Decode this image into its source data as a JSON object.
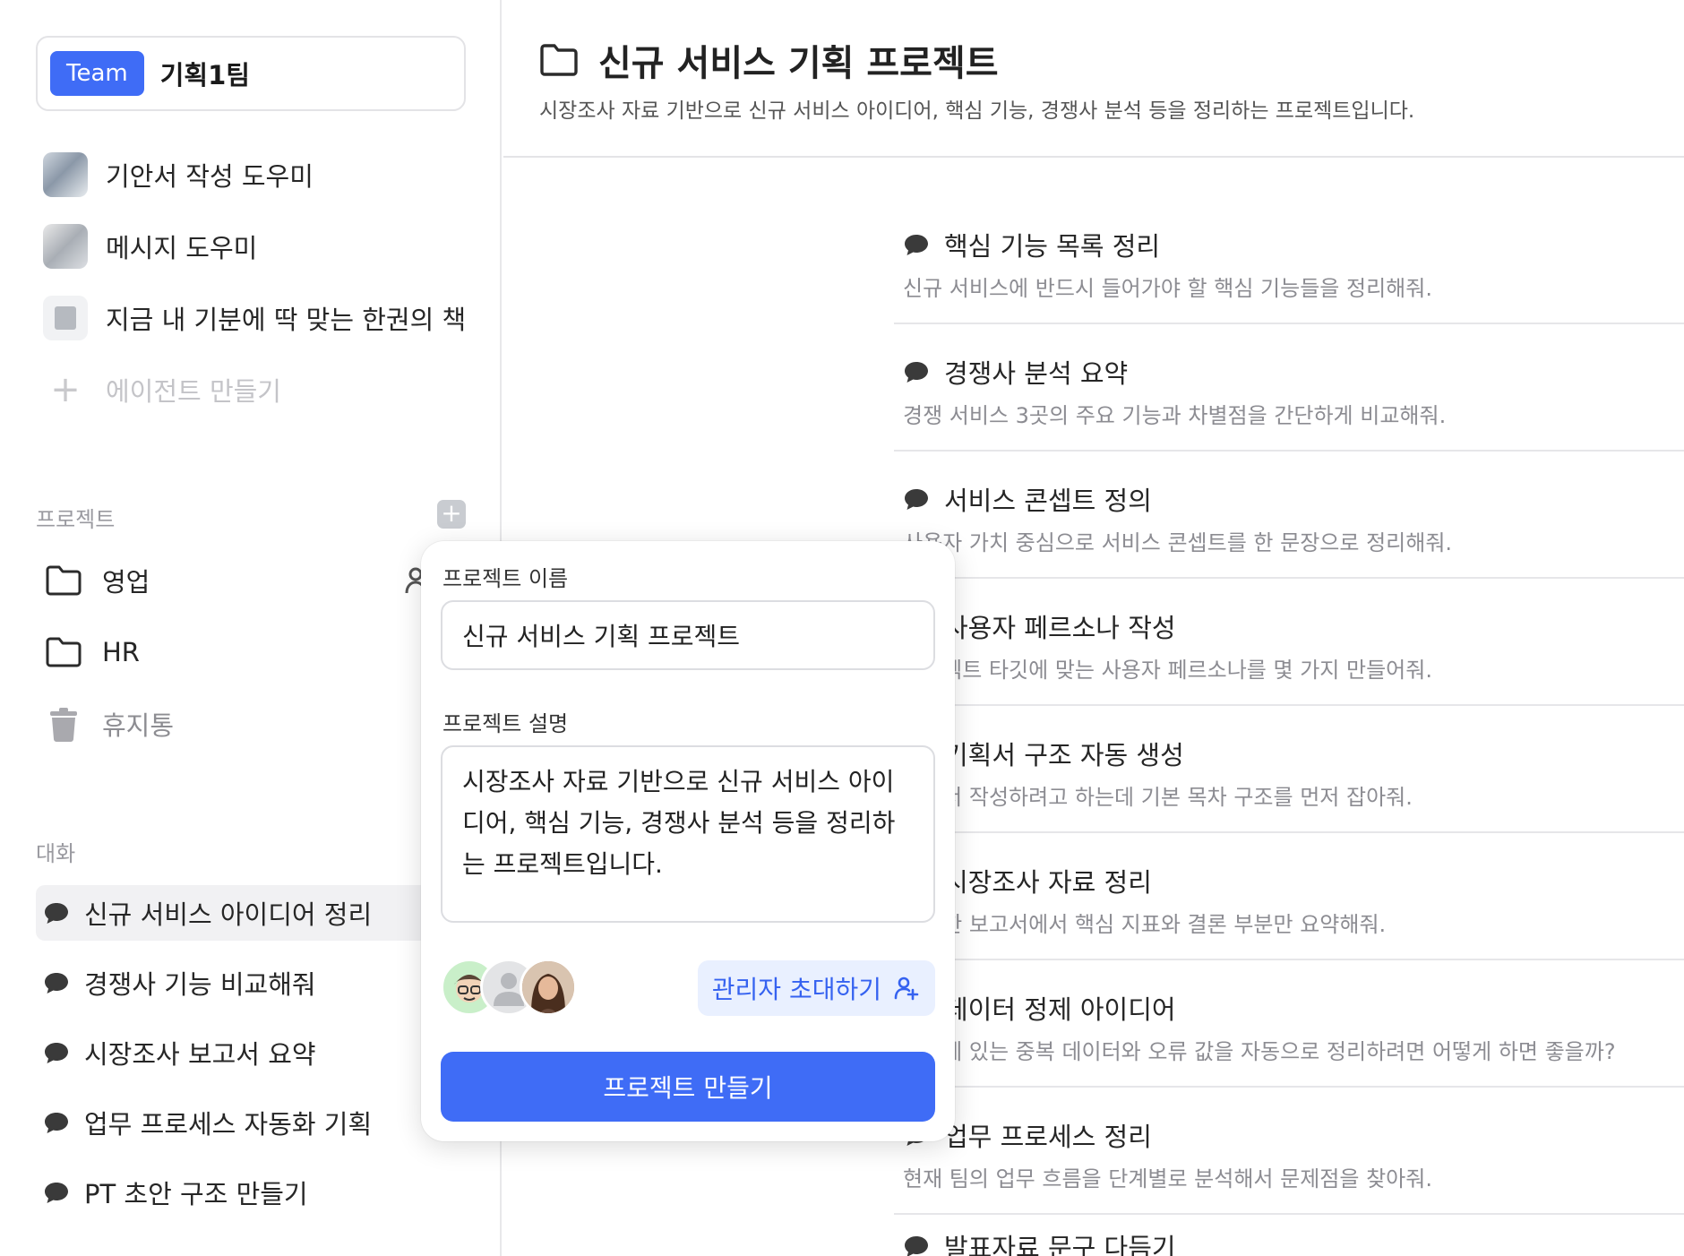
{
  "sidebar": {
    "team_badge": "Team",
    "team_name": "기획1팀",
    "agents": [
      {
        "label": "기안서 작성 도우미"
      },
      {
        "label": "메시지 도우미"
      },
      {
        "label": "지금 내 기분에 딱 맞는 한권의 책"
      }
    ],
    "add_agent": "에이전트 만들기",
    "projects_section": "프로젝트",
    "projects": [
      {
        "label": "영업"
      },
      {
        "label": "HR"
      },
      {
        "label": "휴지통"
      }
    ],
    "chats_section": "대화",
    "chats": [
      {
        "label": "신규 서비스 아이디어 정리",
        "active": true
      },
      {
        "label": "경쟁사 기능 비교해줘"
      },
      {
        "label": "시장조사 보고서 요약"
      },
      {
        "label": "업무 프로세스 자동화 기획"
      },
      {
        "label": "PT 초안 구조 만들기"
      }
    ]
  },
  "main": {
    "title": "신규 서비스 기획 프로젝트",
    "description": "시장조사 자료 기반으로 신규 서비스 아이디어, 핵심 기능, 경쟁사 분석 등을 정리하는 프로젝트입니다.",
    "prompts": [
      {
        "title": "핵심 기능 목록 정리",
        "desc": "신규 서비스에 반드시 들어가야 할 핵심 기능들을 정리해줘."
      },
      {
        "title": "경쟁사 분석 요약",
        "desc": "경쟁 서비스 3곳의 주요 기능과 차별점을 간단하게 비교해줘."
      },
      {
        "title": "서비스 콘셉트 정의",
        "desc": "사용자 가치 중심으로 서비스 콘셉트를 한 문장으로 정리해줘."
      },
      {
        "title": "사용자 페르소나 작성",
        "desc": "프로젝트 타깃에 맞는 사용자 페르소나를 몇 가지 만들어줘."
      },
      {
        "title": "기획서 구조 자동 생성",
        "desc": "기획서 작성하려고 하는데 기본 목차 구조를 먼저 잡아줘."
      },
      {
        "title": "시장조사 자료 정리",
        "desc": "첨부한 보고서에서 핵심 지표와 결론 부분만 요약해줘."
      },
      {
        "title": "데이터 정제 아이디어",
        "desc": "엑셀에 있는 중복 데이터와 오류 값을 자동으로 정리하려면 어떻게 하면 좋을까?"
      },
      {
        "title": "업무 프로세스 정리",
        "desc": "현재 팀의 업무 흐름을 단계별로 분석해서 문제점을 찾아줘."
      },
      {
        "title": "발표자료 문구 다듬기",
        "desc": ""
      }
    ]
  },
  "modal": {
    "name_label": "프로젝트 이름",
    "name_value": "신규 서비스 기획 프로젝트",
    "desc_label": "프로젝트 설명",
    "desc_value": "시장조사 자료 기반으로 신규 서비스 아이디어, 핵심 기능, 경쟁사 분석 등을 정리하는 프로젝트입니다.",
    "invite_label": "관리자 초대하기",
    "create_label": "프로젝트 만들기"
  },
  "colors": {
    "accent": "#3f6cf6",
    "invite_bg": "#e9f0ff",
    "invite_text": "#3562f0"
  },
  "icons": [
    "folder-icon",
    "chat-bubble-icon",
    "trash-icon",
    "plus-icon",
    "add-person-icon",
    "book-icon"
  ]
}
